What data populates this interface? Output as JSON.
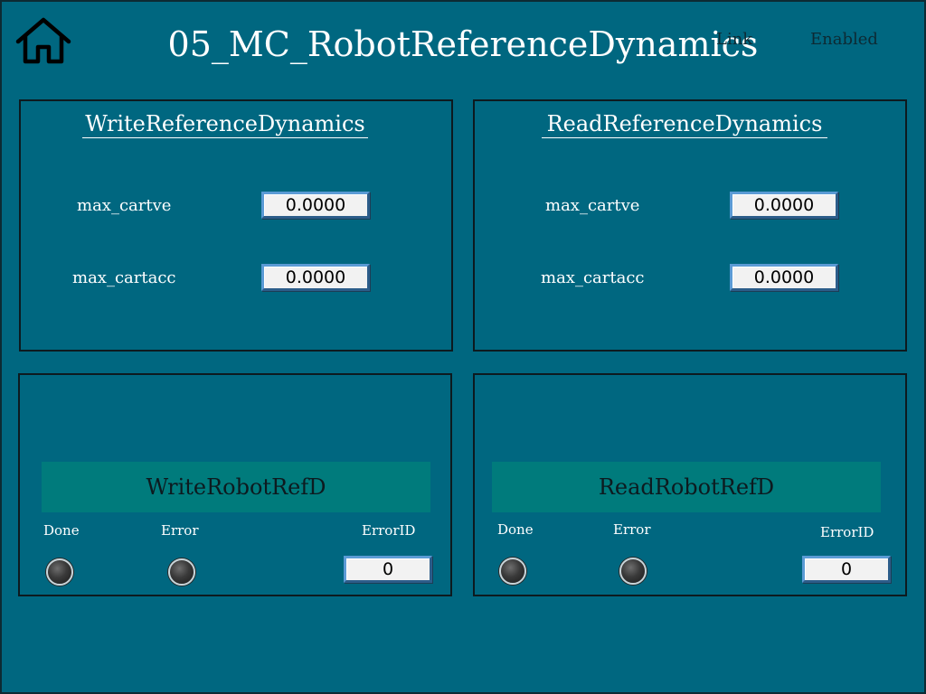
{
  "header": {
    "title": "05_MC_RobotReferenceDynamics",
    "status_link": "Link",
    "status_enabled": "Enabled",
    "home_icon": "home-icon"
  },
  "write_panel": {
    "title": "WriteReferenceDynamics",
    "max_cartve_label": "max_cartve",
    "max_cartve_value": "0.0000",
    "max_cartacc_label": "max_cartacc",
    "max_cartacc_value": "0.0000"
  },
  "read_panel": {
    "title": "ReadReferenceDynamics",
    "max_cartve_label": "max_cartve",
    "max_cartve_value": "0.0000",
    "max_cartacc_label": "max_cartacc",
    "max_cartacc_value": "0.0000"
  },
  "write_control": {
    "button_label": "WriteRobotRefD",
    "done_label": "Done",
    "error_label": "Error",
    "errorid_label": "ErrorID",
    "errorid_value": "0"
  },
  "read_control": {
    "button_label": "ReadRobotRefD",
    "done_label": "Done",
    "error_label": "Error",
    "errorid_label": "ErrorID",
    "errorid_value": "0"
  },
  "colors": {
    "background": "#006780",
    "button": "#007b7c",
    "field_border": "#5b9bd5"
  }
}
